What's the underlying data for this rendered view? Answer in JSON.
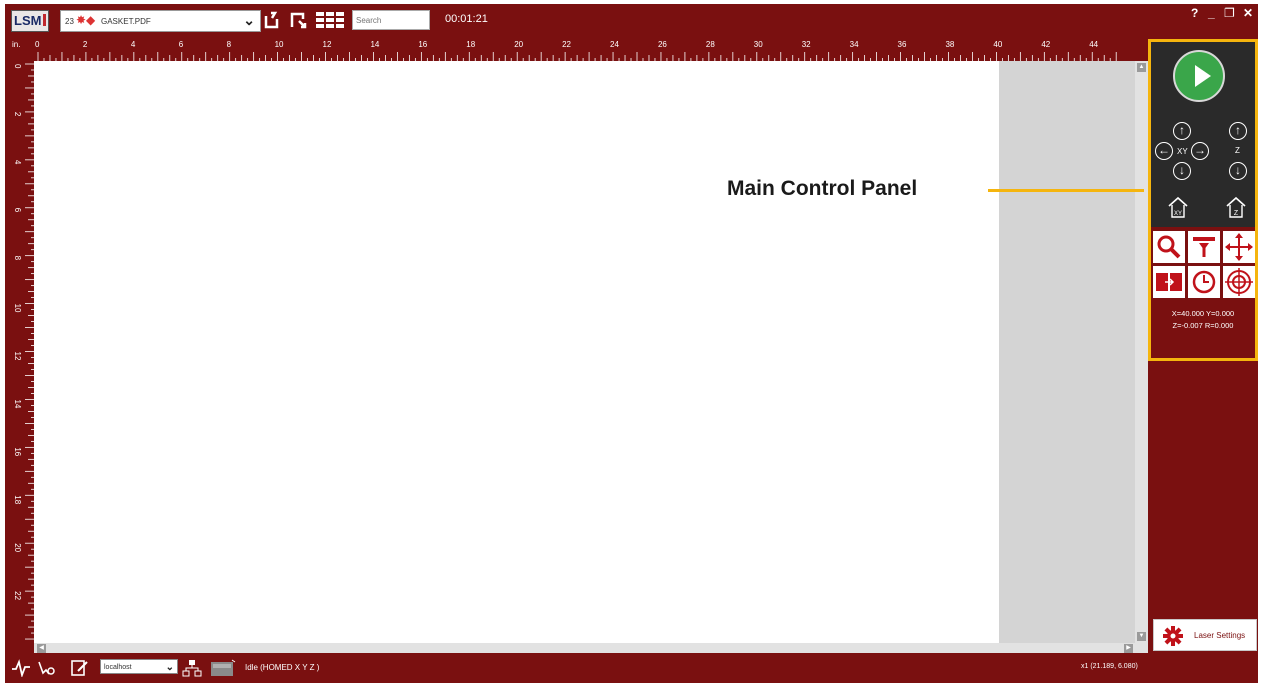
{
  "app": {
    "logo": "LSM",
    "file_number": "23",
    "file_name": "GASKET.PDF",
    "search_placeholder": "Search",
    "timer": "00:01:21",
    "window_controls": [
      "?",
      "_",
      "❐",
      "✕"
    ]
  },
  "ruler": {
    "unit": "in.",
    "h_labels": [
      "0",
      "2",
      "4",
      "6",
      "8",
      "10",
      "12",
      "14",
      "16",
      "18",
      "20",
      "22",
      "24",
      "26",
      "28",
      "30",
      "32",
      "34",
      "36",
      "38",
      "40",
      "42",
      "44"
    ],
    "v_labels": [
      "0",
      "2",
      "4",
      "6",
      "8",
      "10",
      "12",
      "14",
      "16",
      "18",
      "20",
      "22"
    ]
  },
  "control_panel": {
    "xy_label": "XY",
    "z_label": "Z",
    "home_xy_label": "XY",
    "home_z_label": "Z",
    "coord_line1": "X=40.000  Y=0.000",
    "coord_line2": "Z=-0.007  R=0.000",
    "tools": [
      "search-icon",
      "filter-icon",
      "move-icon",
      "frame-icon",
      "clock-icon",
      "target-icon"
    ]
  },
  "laser_settings": {
    "label": "Laser Settings"
  },
  "statusbar": {
    "host": "localhost",
    "status": "Idle (HOMED X Y Z )",
    "position": "x1  (21.189, 6.080)"
  },
  "annotation": {
    "callout": "Main Control Panel"
  },
  "colors": {
    "brand": "#7a1010",
    "highlight": "#f5b50e",
    "play": "#3aa64a",
    "canvas_gray": "#d4d4d4"
  }
}
